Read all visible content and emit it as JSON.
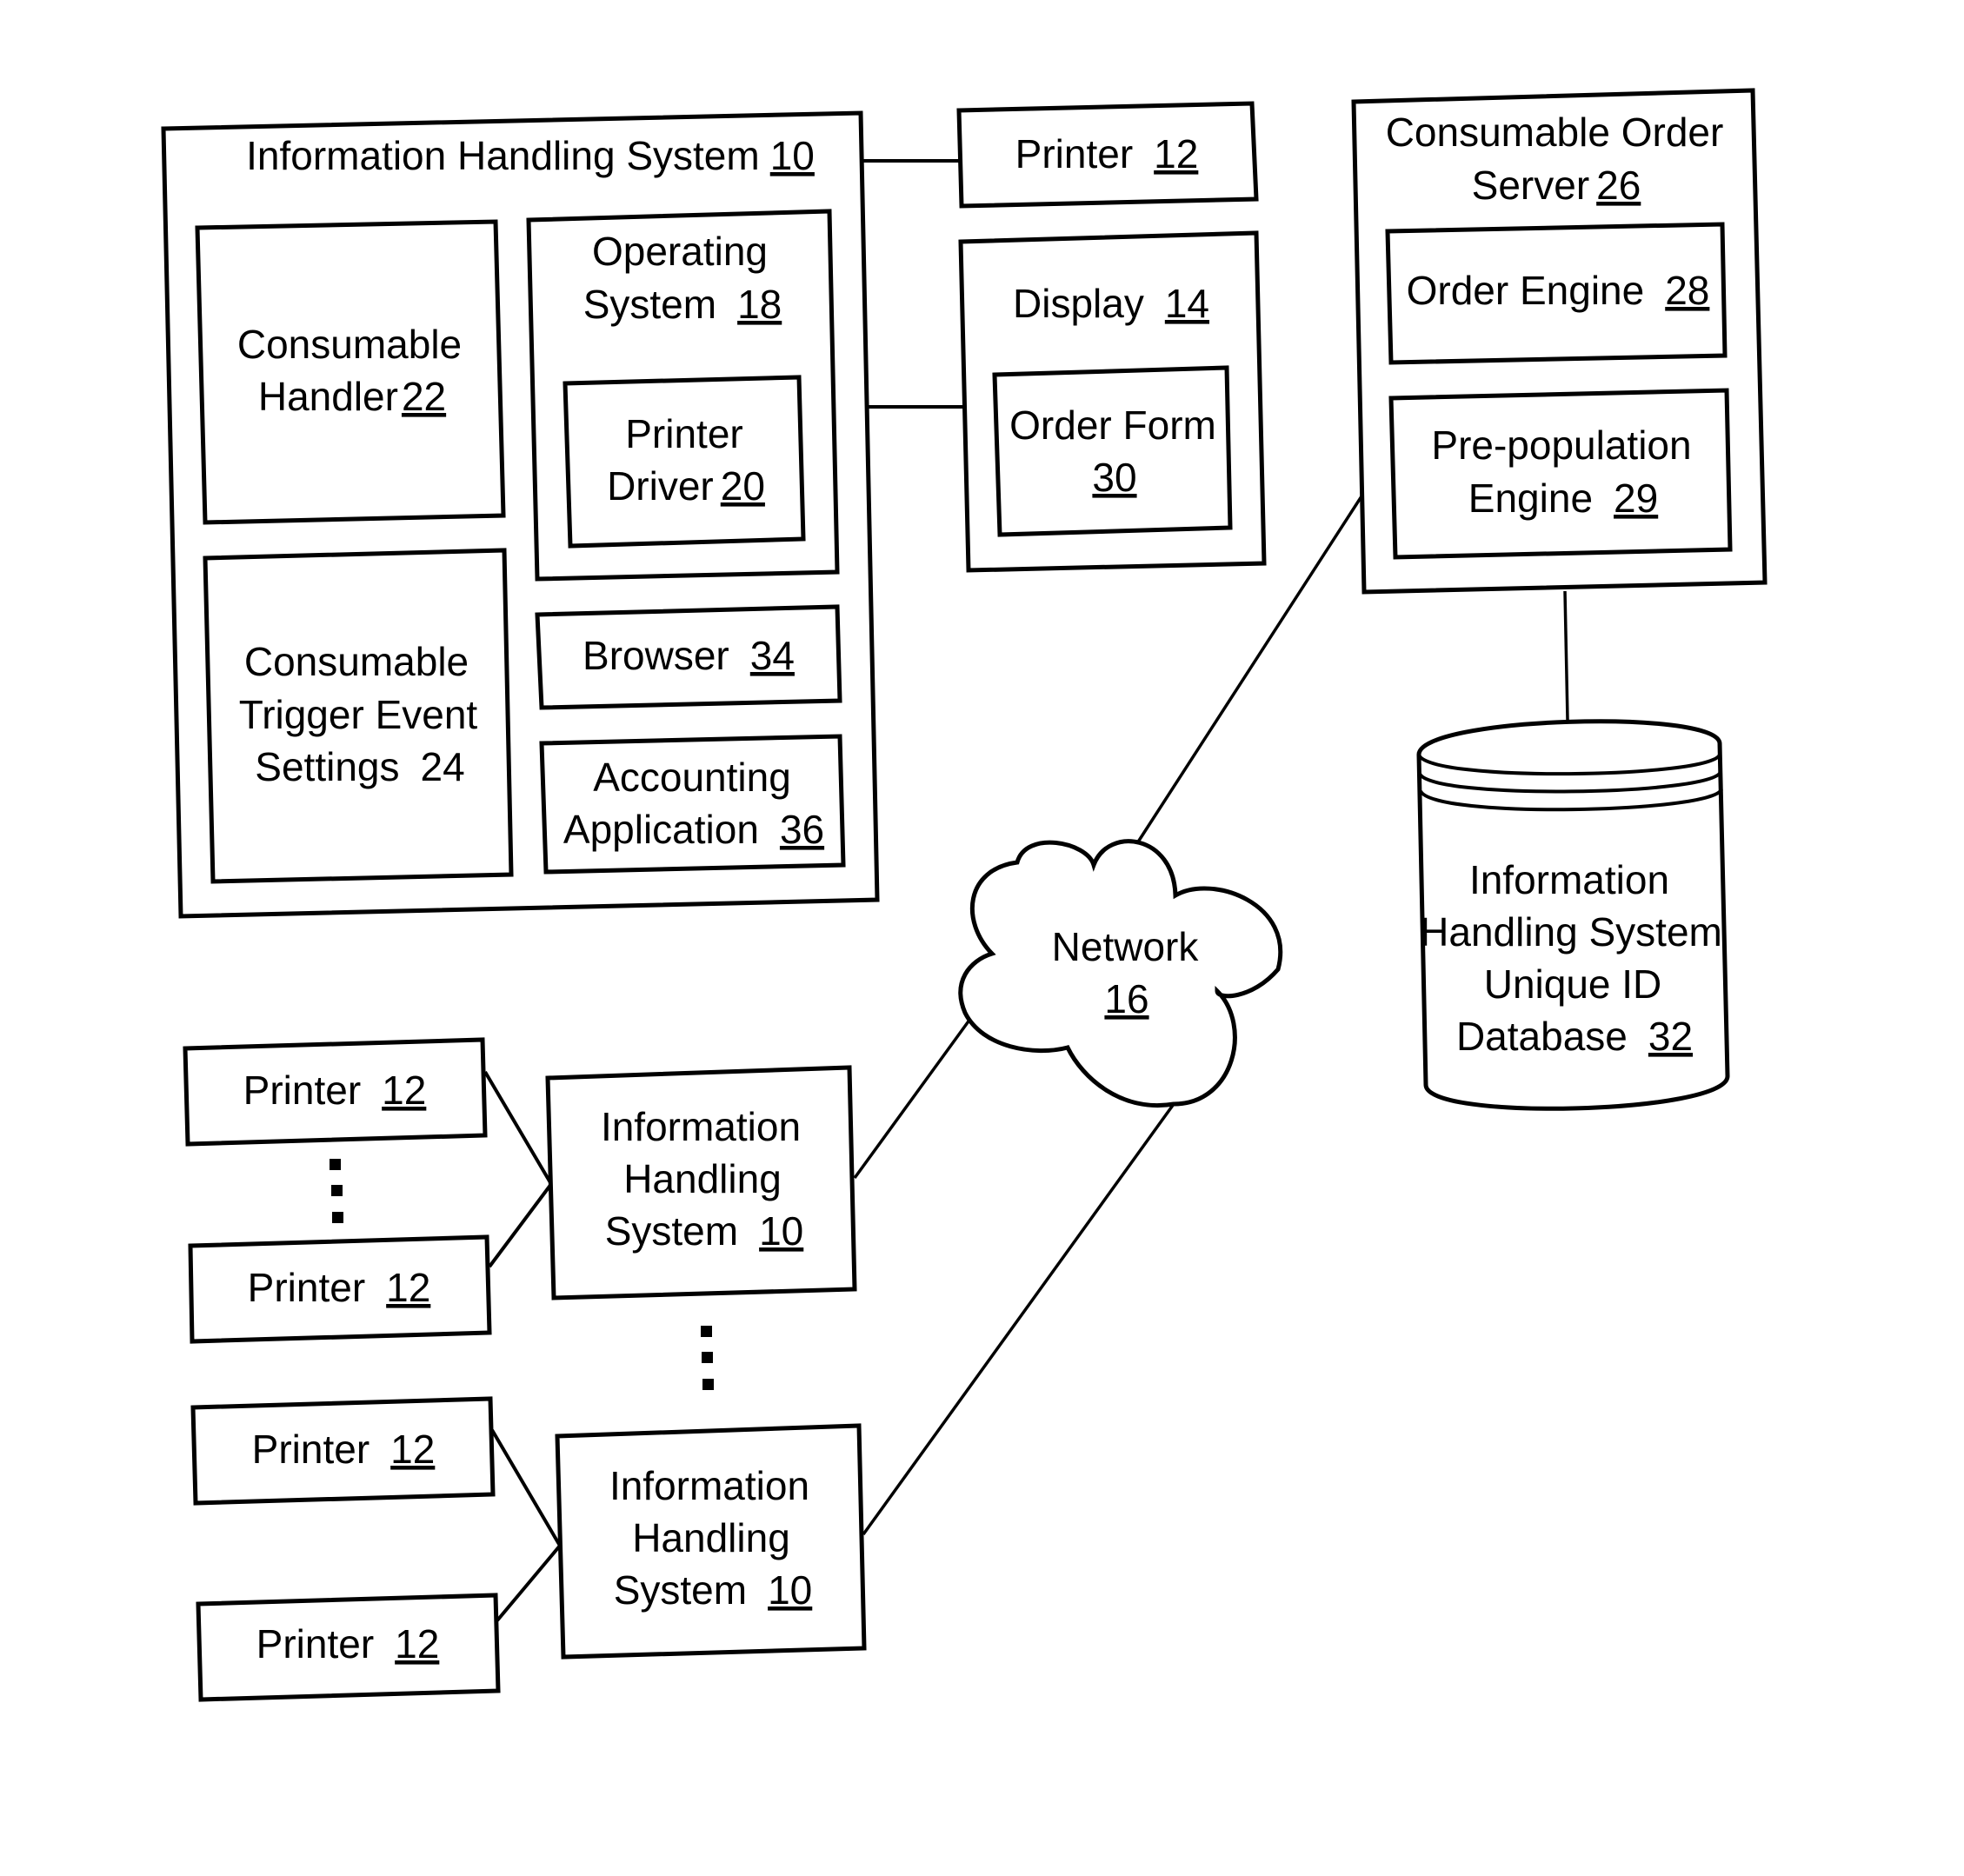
{
  "diagram": {
    "ihs_main": {
      "title": "Information Handling System",
      "ref": "10",
      "components": {
        "consumable_handler": {
          "lines": [
            "Consumable"
          ],
          "last": "Handler",
          "ref": "22"
        },
        "operating_system": {
          "lines": [
            "Operating"
          ],
          "last": "System",
          "ref": "18"
        },
        "printer_driver": {
          "lines": [
            "Printer"
          ],
          "last": "Driver",
          "ref": "20"
        },
        "trigger_settings": {
          "lines": [
            "Consumable",
            "Trigger Event"
          ],
          "last": "Settings",
          "ref": "24",
          "ref_underlined": false
        },
        "browser": {
          "last": "Browser",
          "ref": "34"
        },
        "accounting": {
          "lines": [
            "Accounting"
          ],
          "last": "Application",
          "ref": "36"
        }
      }
    },
    "printer_top": {
      "label": "Printer",
      "ref": "12"
    },
    "display": {
      "label": "Display",
      "ref": "14"
    },
    "order_form": {
      "label": "Order Form",
      "ref": "30"
    },
    "order_server": {
      "lines": [
        "Consumable Order"
      ],
      "last": "Server",
      "ref": "26",
      "order_engine": {
        "label": "Order Engine",
        "ref": "28"
      },
      "prepopulation_engine": {
        "lines": [
          "Pre-population"
        ],
        "last": "Engine",
        "ref": "29"
      }
    },
    "database": {
      "lines": [
        "Information",
        "Handling System",
        "Unique ID"
      ],
      "last": "Database",
      "ref": "32"
    },
    "network": {
      "label": "Network",
      "ref": "16"
    },
    "remote_ihs": [
      {
        "lines": [
          "Information",
          "Handling"
        ],
        "last": "System",
        "ref": "10",
        "printers": [
          {
            "label": "Printer",
            "ref": "12"
          },
          {
            "label": "Printer",
            "ref": "12"
          }
        ]
      },
      {
        "lines": [
          "Information",
          "Handling"
        ],
        "last": "System",
        "ref": "10",
        "printers": [
          {
            "label": "Printer",
            "ref": "12"
          },
          {
            "label": "Printer",
            "ref": "12"
          }
        ]
      }
    ],
    "ellipsis": "⋮"
  }
}
